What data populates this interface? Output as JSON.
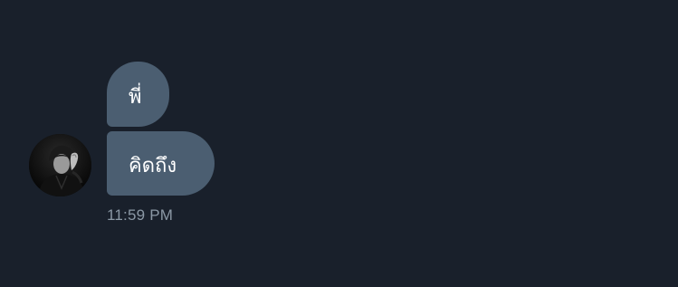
{
  "conversation": {
    "messages": [
      {
        "text": "พี่"
      },
      {
        "text": "คิดถึง"
      }
    ],
    "timestamp": "11:59 PM"
  },
  "colors": {
    "background": "#19202b",
    "bubble": "#4b5e71",
    "bubble_text": "#ffffff",
    "timestamp_text": "#8b98a5"
  },
  "icons": {
    "avatar": "profile-photo"
  }
}
